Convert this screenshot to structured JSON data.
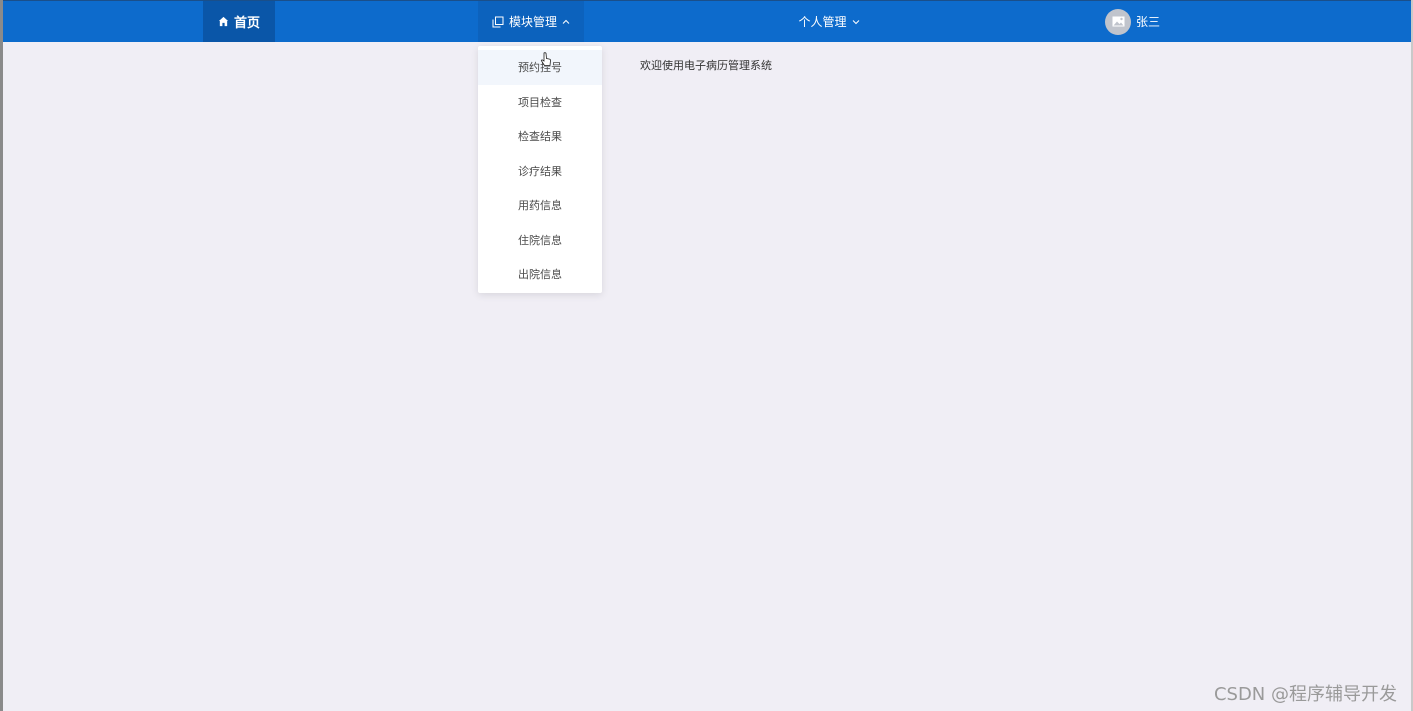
{
  "nav": {
    "home_label": "首页",
    "module_label": "模块管理",
    "personal_label": "个人管理",
    "user_name": "张三",
    "bar_color": "#0d6bcc"
  },
  "module_menu": {
    "items": [
      {
        "label": "预约挂号"
      },
      {
        "label": "项目检查"
      },
      {
        "label": "检查结果"
      },
      {
        "label": "诊疗结果"
      },
      {
        "label": "用药信息"
      },
      {
        "label": "住院信息"
      },
      {
        "label": "出院信息"
      }
    ]
  },
  "main": {
    "welcome_text": "欢迎使用电子病历管理系统"
  },
  "watermark": {
    "text": "CSDN @程序辅导开发"
  },
  "icons": {
    "home": "home-icon",
    "module": "copy-icon",
    "chevron_up": "chevron-up-icon",
    "chevron_down": "chevron-down-icon",
    "avatar": "image-icon"
  }
}
